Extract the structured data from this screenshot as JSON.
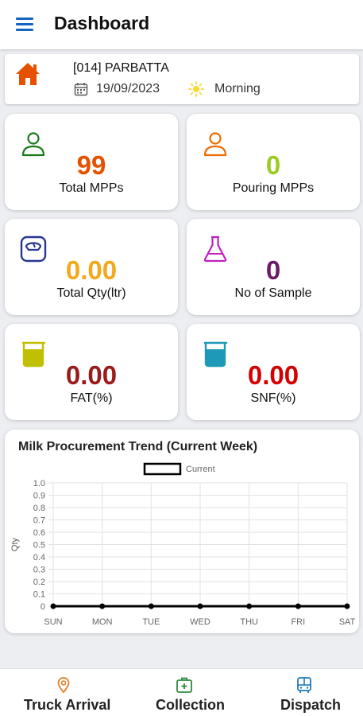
{
  "header": {
    "title": "Dashboard",
    "menu_icon": "hamburger-menu-icon"
  },
  "info": {
    "mpp_name": "[014] PARBATTA",
    "date": "19/09/2023",
    "shift": "Morning",
    "home_color": "#e65100",
    "sun_color": "#fdd835"
  },
  "stats": [
    {
      "value": "99",
      "label": "Total MPPs",
      "icon": "person-icon",
      "value_color": "#e65100",
      "icon_color": "#1b7a1b"
    },
    {
      "value": "0",
      "label": "Pouring MPPs",
      "icon": "person-icon",
      "value_color": "#9ccc24",
      "icon_color": "#ef6c00"
    },
    {
      "value": "0.00",
      "label": "Total Qty(ltr)",
      "icon": "scale-icon",
      "value_color": "#f4a81b",
      "icon_color": "#283593"
    },
    {
      "value": "0",
      "label": "No of Sample",
      "icon": "flask-icon",
      "value_color": "#6a1b6a",
      "icon_color": "#c020c0"
    },
    {
      "value": "0.00",
      "label": "FAT(%)",
      "icon": "beaker-icon",
      "value_color": "#9b1b1b",
      "icon_color": "#c0c000"
    },
    {
      "value": "0.00",
      "label": "SNF(%)",
      "icon": "beaker-icon",
      "value_color": "#d50000",
      "icon_color": "#1e9ab8"
    }
  ],
  "chart_data": {
    "type": "line",
    "title": "Milk Procurement Trend (Current Week)",
    "categories": [
      "SUN",
      "MON",
      "TUE",
      "WED",
      "THU",
      "FRI",
      "SAT"
    ],
    "series": [
      {
        "name": "Current",
        "values": [
          0,
          0,
          0,
          0,
          0,
          0,
          0
        ]
      }
    ],
    "xlabel": "",
    "ylabel": "Qty",
    "ylim": [
      0,
      1.0
    ],
    "yticks": [
      "0",
      "0.1",
      "0.2",
      "0.3",
      "0.4",
      "0.5",
      "0.6",
      "0.7",
      "0.8",
      "0.9",
      "1.0"
    ],
    "grid": true,
    "legend": "top-center",
    "series_color": "#000000"
  },
  "bottom_nav": [
    {
      "label": "Truck Arrival",
      "icon": "location-pin-icon",
      "icon_color": "#e67e22"
    },
    {
      "label": "Collection",
      "icon": "medical-bag-icon",
      "icon_color": "#2e8b3e"
    },
    {
      "label": "Dispatch",
      "icon": "bus-icon",
      "icon_color": "#1e7ab8"
    }
  ]
}
